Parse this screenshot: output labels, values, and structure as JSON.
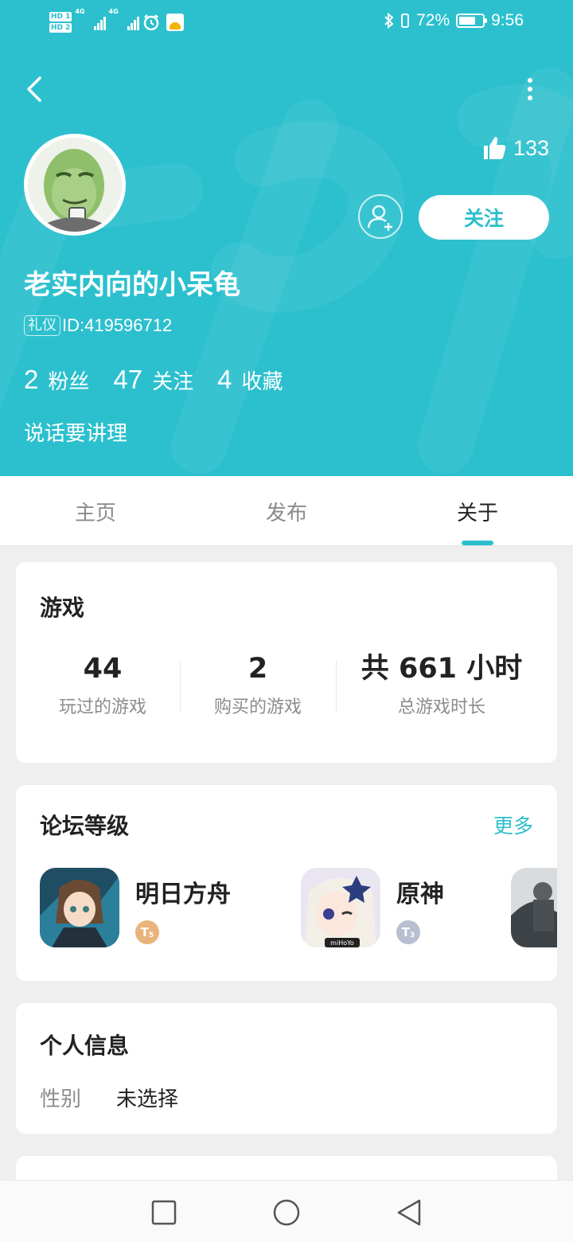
{
  "status_bar": {
    "left_badges": [
      "HD 1",
      "HD 2"
    ],
    "network": [
      "4G",
      "4G"
    ],
    "battery_percent": "72%",
    "battery_level": 0.72,
    "time": "9:56"
  },
  "header": {
    "background_color": "#2cc0ce",
    "likes_count": "133",
    "follow_label": "关注",
    "username": "老实内向的小呆龟",
    "tag": "礼仪",
    "user_id": "ID:419596712",
    "stats": [
      {
        "value": "2",
        "label": "粉丝"
      },
      {
        "value": "47",
        "label": "关注"
      },
      {
        "value": "4",
        "label": "收藏"
      }
    ],
    "bio": "说话要讲理"
  },
  "tabs": [
    {
      "label": "主页",
      "active": false
    },
    {
      "label": "发布",
      "active": false
    },
    {
      "label": "关于",
      "active": true
    }
  ],
  "games_card": {
    "title": "游戏",
    "stats": [
      {
        "value": "44",
        "label": "玩过的游戏"
      },
      {
        "value": "2",
        "label": "购买的游戏"
      },
      {
        "value": "共 661 小时",
        "label": "总游戏时长"
      }
    ]
  },
  "forum_card": {
    "title": "论坛等级",
    "more_label": "更多",
    "items": [
      {
        "name": "明日方舟",
        "level_letter": "T",
        "level_num": "5",
        "level_color": "#e9b47c"
      },
      {
        "name": "原神",
        "level_letter": "T",
        "level_num": "3",
        "level_color": "#b9bfd0"
      }
    ]
  },
  "info_card": {
    "title": "个人信息",
    "rows": [
      {
        "key": "性别",
        "value": "未选择"
      }
    ]
  },
  "accent_color": "#2cbfcc",
  "icons": [
    "back-arrow-icon",
    "more-vertical-icon",
    "thumbs-up-icon",
    "add-friend-icon",
    "nav-square-icon",
    "nav-circle-icon",
    "nav-triangle-icon"
  ]
}
